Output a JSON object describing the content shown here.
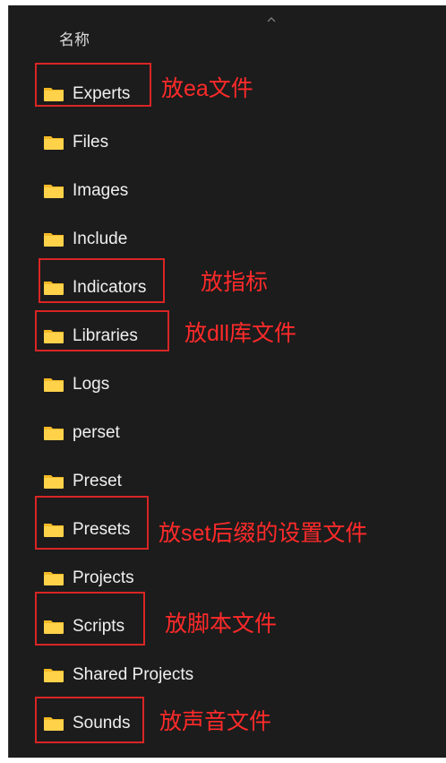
{
  "header": {
    "name_column": "名称",
    "sort_indicator": "chevron-up-icon"
  },
  "folder_icon": {
    "icon": "folder-icon",
    "color_top": "#f2b825",
    "color_body": "#ffd24a"
  },
  "items": [
    {
      "label": "Experts",
      "highlighted": true,
      "note": "放ea文件"
    },
    {
      "label": "Files",
      "highlighted": false,
      "note": ""
    },
    {
      "label": "Images",
      "highlighted": false,
      "note": ""
    },
    {
      "label": "Include",
      "highlighted": false,
      "note": ""
    },
    {
      "label": "Indicators",
      "highlighted": true,
      "note": "放指标"
    },
    {
      "label": "Libraries",
      "highlighted": true,
      "note": "放dll库文件"
    },
    {
      "label": "Logs",
      "highlighted": false,
      "note": ""
    },
    {
      "label": "perset",
      "highlighted": false,
      "note": ""
    },
    {
      "label": "Preset",
      "highlighted": false,
      "note": ""
    },
    {
      "label": "Presets",
      "highlighted": true,
      "note": "放set后缀的设置文件"
    },
    {
      "label": "Projects",
      "highlighted": false,
      "note": ""
    },
    {
      "label": "Scripts",
      "highlighted": true,
      "note": "放脚本文件"
    },
    {
      "label": "Shared Projects",
      "highlighted": false,
      "note": ""
    },
    {
      "label": "Sounds",
      "highlighted": true,
      "note": "放声音文件"
    }
  ],
  "colors": {
    "background": "#1c1c1c",
    "text": "#f0f0f0",
    "annotation": "#ff2a2a",
    "annotation_box": "#d92525"
  }
}
